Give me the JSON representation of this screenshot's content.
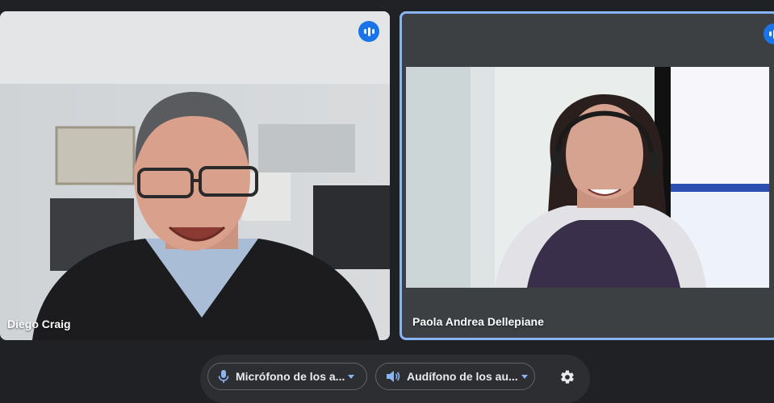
{
  "participants": [
    {
      "name": "Diego Craig",
      "speaking": true
    },
    {
      "name": "Paola Andrea Dellepiane",
      "speaking": true,
      "active_speaker": true
    }
  ],
  "controls": {
    "microphone_label": "Micrófono de los a...",
    "speaker_label": "Audífono de los au...",
    "icons": [
      "microphone-icon",
      "speaker-icon",
      "settings-icon"
    ]
  },
  "colors": {
    "background": "#202124",
    "tile": "#3c4043",
    "active_border": "#8ab4f8",
    "accent": "#1a73e8"
  }
}
